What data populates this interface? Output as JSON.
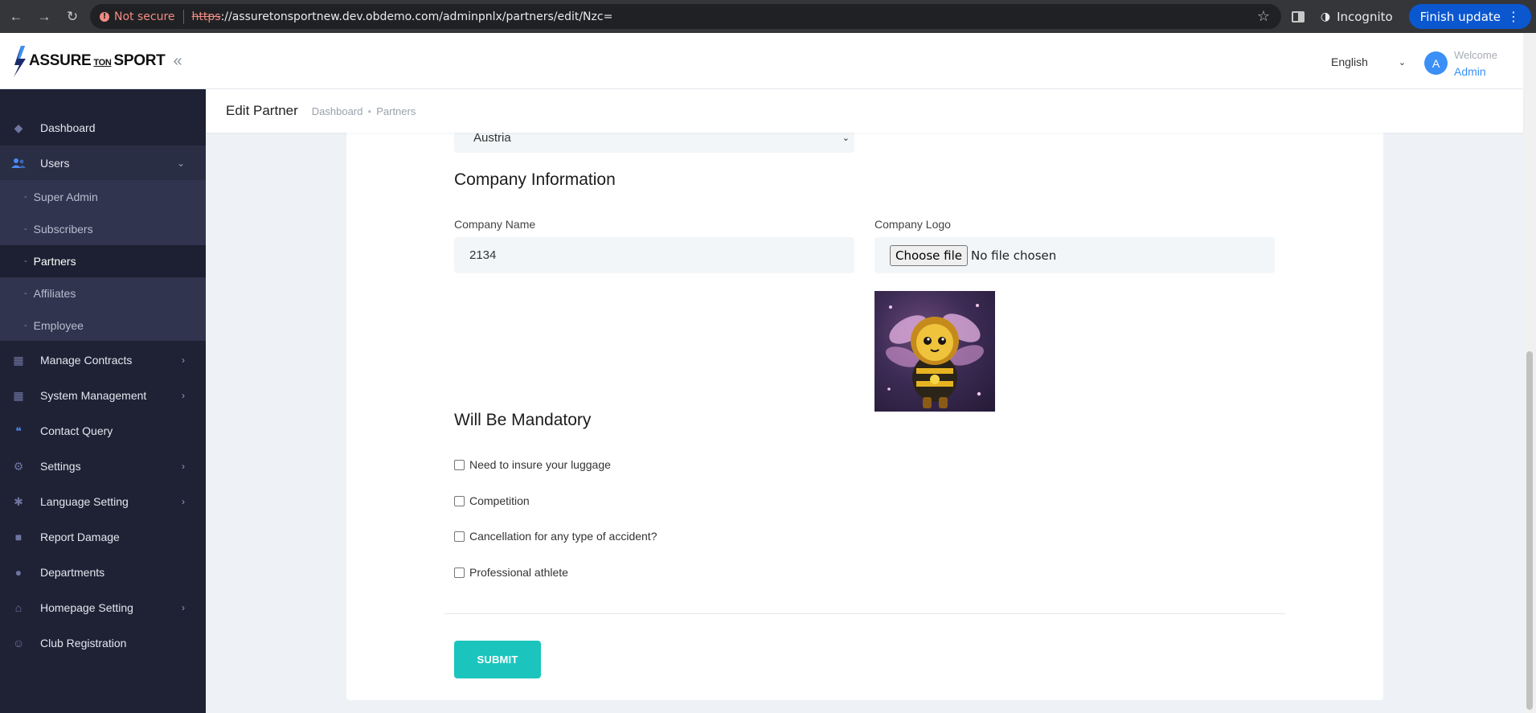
{
  "browser": {
    "security_label": "Not secure",
    "url_scheme": "https",
    "url_rest": "://assuretonsportnew.dev.obdemo.com/adminpnlx/partners/edit/Nzc=",
    "incognito_label": "Incognito",
    "update_label": "Finish update"
  },
  "header": {
    "logo_main": "ASSURE",
    "logo_ton": "TON",
    "logo_sport": "SPORT",
    "language": "English",
    "avatar_letter": "A",
    "welcome": "Welcome",
    "user": "Admin"
  },
  "sidebar": {
    "items": [
      {
        "label": "Dashboard",
        "icon": "diamond-icon"
      },
      {
        "label": "Users",
        "icon": "users-icon"
      },
      {
        "label": "Manage Contracts",
        "icon": "contracts-icon"
      },
      {
        "label": "System Management",
        "icon": "system-icon"
      },
      {
        "label": "Contact Query",
        "icon": "quote-icon"
      },
      {
        "label": "Settings",
        "icon": "gear-icon"
      },
      {
        "label": "Language Setting",
        "icon": "language-icon"
      },
      {
        "label": "Report Damage",
        "icon": "report-icon"
      },
      {
        "label": "Departments",
        "icon": "departments-icon"
      },
      {
        "label": "Homepage Setting",
        "icon": "home-icon"
      },
      {
        "label": "Club Registration",
        "icon": "user-add-icon"
      }
    ],
    "users_sub": [
      {
        "label": "Super Admin"
      },
      {
        "label": "Subscribers"
      },
      {
        "label": "Partners"
      },
      {
        "label": "Affiliates"
      },
      {
        "label": "Employee"
      }
    ],
    "sub_dash": "-"
  },
  "page": {
    "title": "Edit Partner",
    "breadcrumb": [
      "Dashboard",
      "Partners"
    ]
  },
  "form": {
    "country_value": "Austria",
    "company_section": "Company Information",
    "company_name_label": "Company Name",
    "company_name_value": "2134",
    "company_logo_label": "Company Logo",
    "choose_file": "Choose file",
    "no_file": "No file chosen",
    "mandatory_section": "Will Be Mandatory",
    "checkboxes": [
      {
        "label": "Need to insure your luggage",
        "checked": false
      },
      {
        "label": "Competition",
        "checked": false
      },
      {
        "label": "Cancellation for any type of accident?",
        "checked": false
      },
      {
        "label": "Professional athlete",
        "checked": false
      }
    ],
    "submit_label": "SUBMIT"
  },
  "colors": {
    "sidebar_bg": "#1f2235",
    "accent_blue": "#3b8ff6",
    "submit_teal": "#1bc5bd"
  }
}
